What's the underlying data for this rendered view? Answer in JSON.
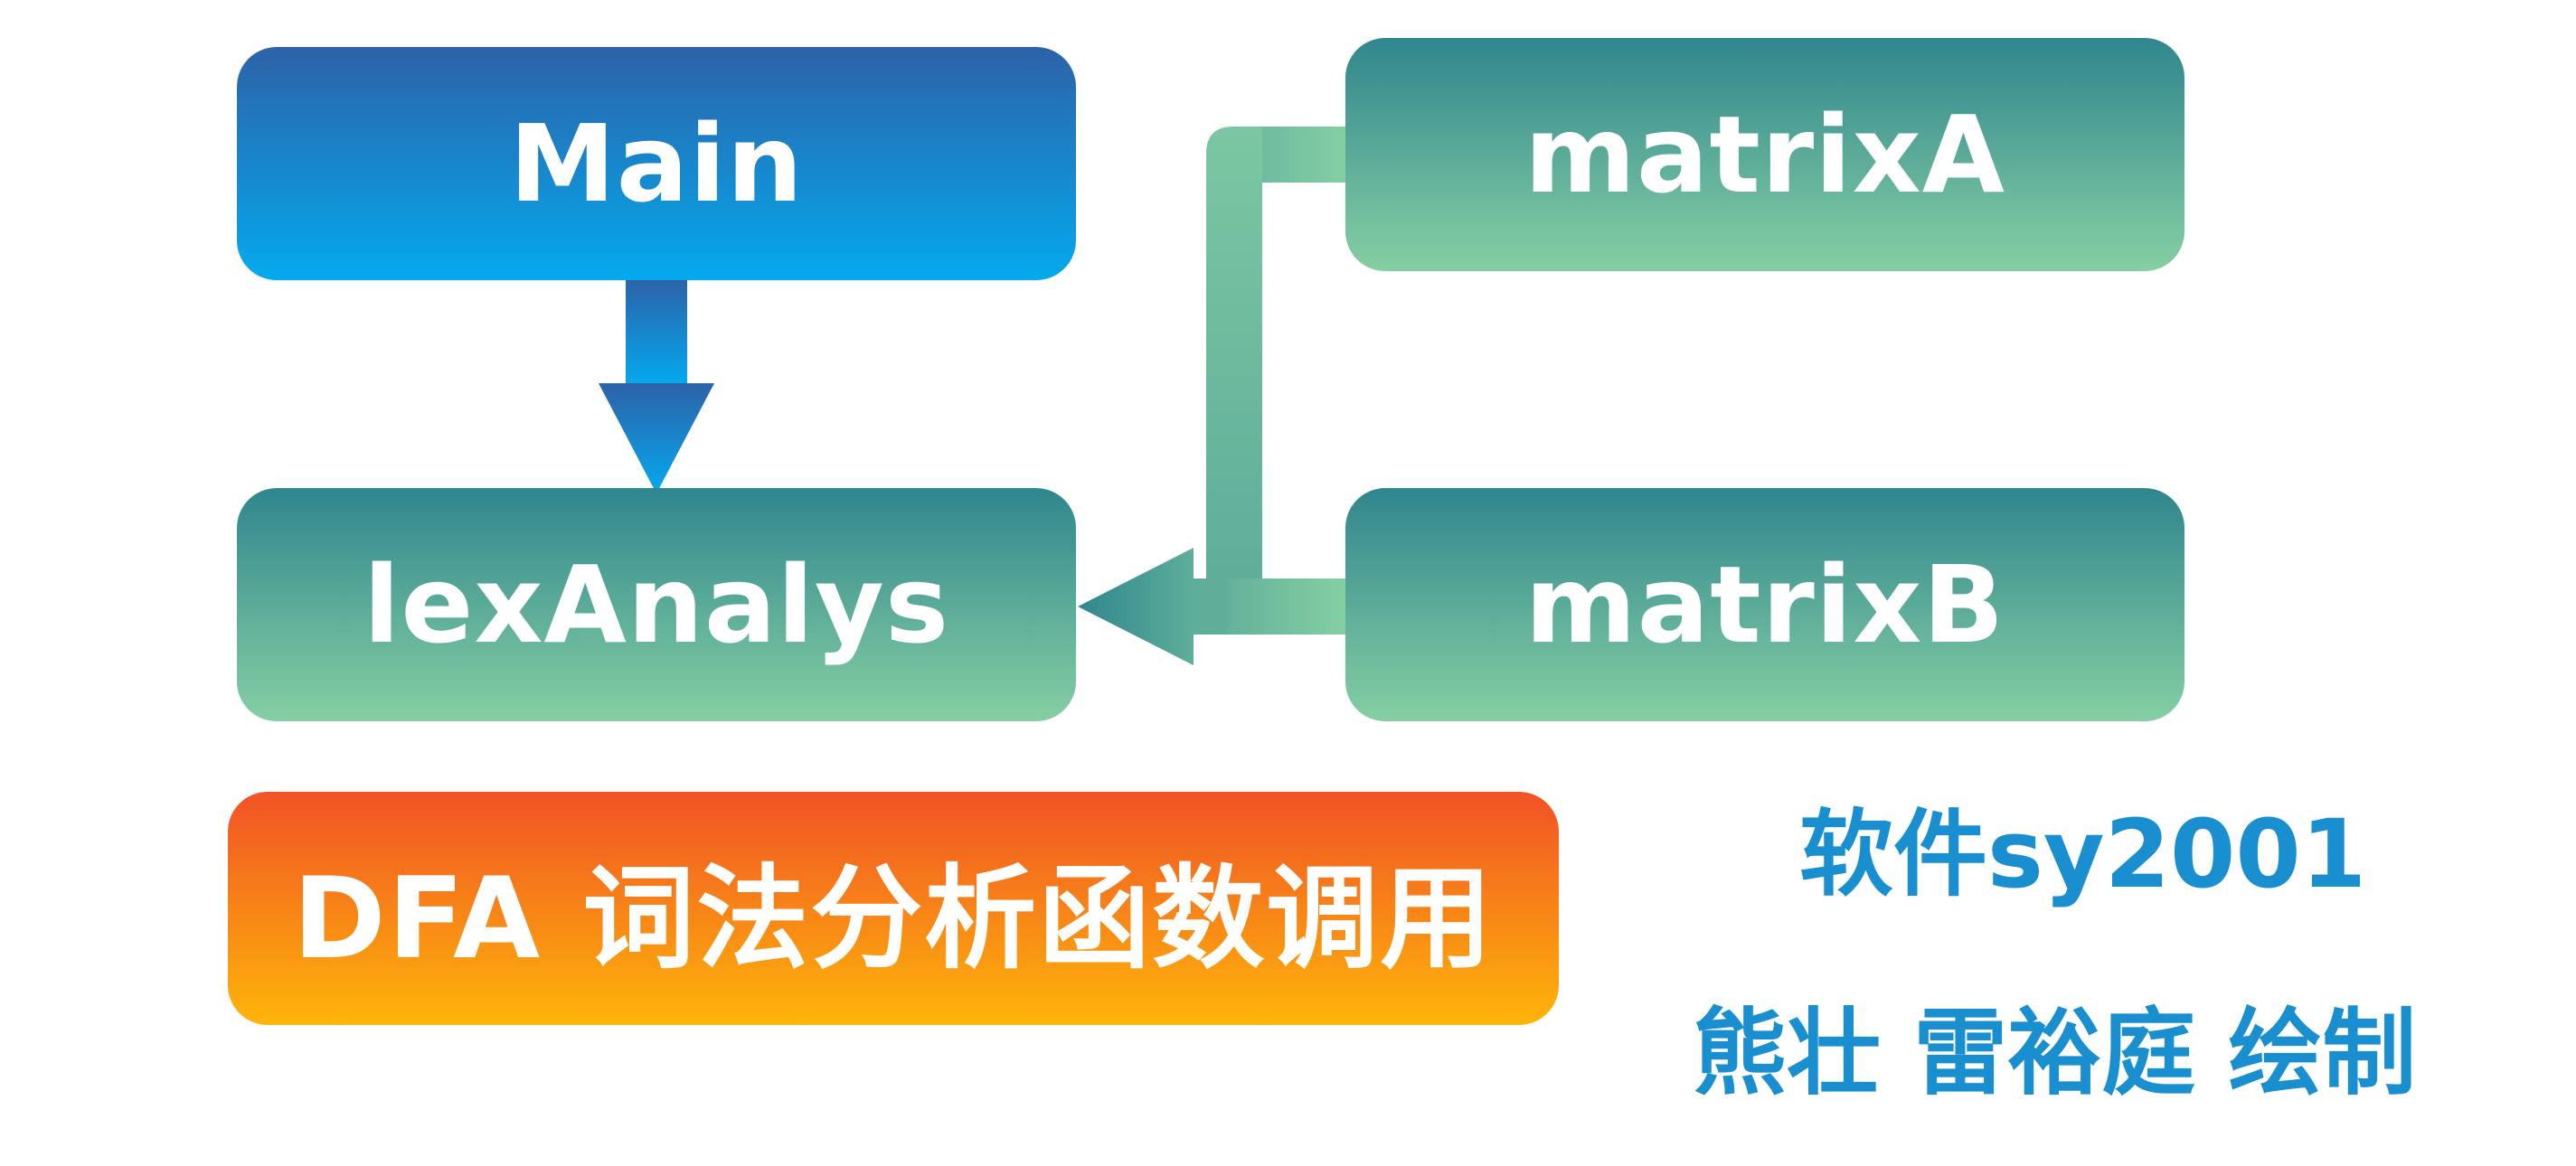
{
  "nodes": {
    "main": "Main",
    "lexAnalys": "lexAnalys",
    "matrixA": "matrixA",
    "matrixB": "matrixB"
  },
  "title": "DFA 词法分析函数调用",
  "captions": {
    "course": "软件sy2001",
    "authors": "熊壮 雷裕庭 绘制"
  },
  "edges": [
    {
      "from": "Main",
      "to": "lexAnalys"
    },
    {
      "from": "matrixA",
      "to": "lexAnalys"
    },
    {
      "from": "matrixB",
      "to": "lexAnalys"
    }
  ],
  "colors": {
    "main_gradient": [
      "#2d62a8",
      "#05a9ee"
    ],
    "teal_gradient": [
      "#2f868d",
      "#86cfa4"
    ],
    "title_gradient": [
      "#f15226",
      "#feb50a"
    ],
    "caption_text": "#1a8fd0"
  }
}
